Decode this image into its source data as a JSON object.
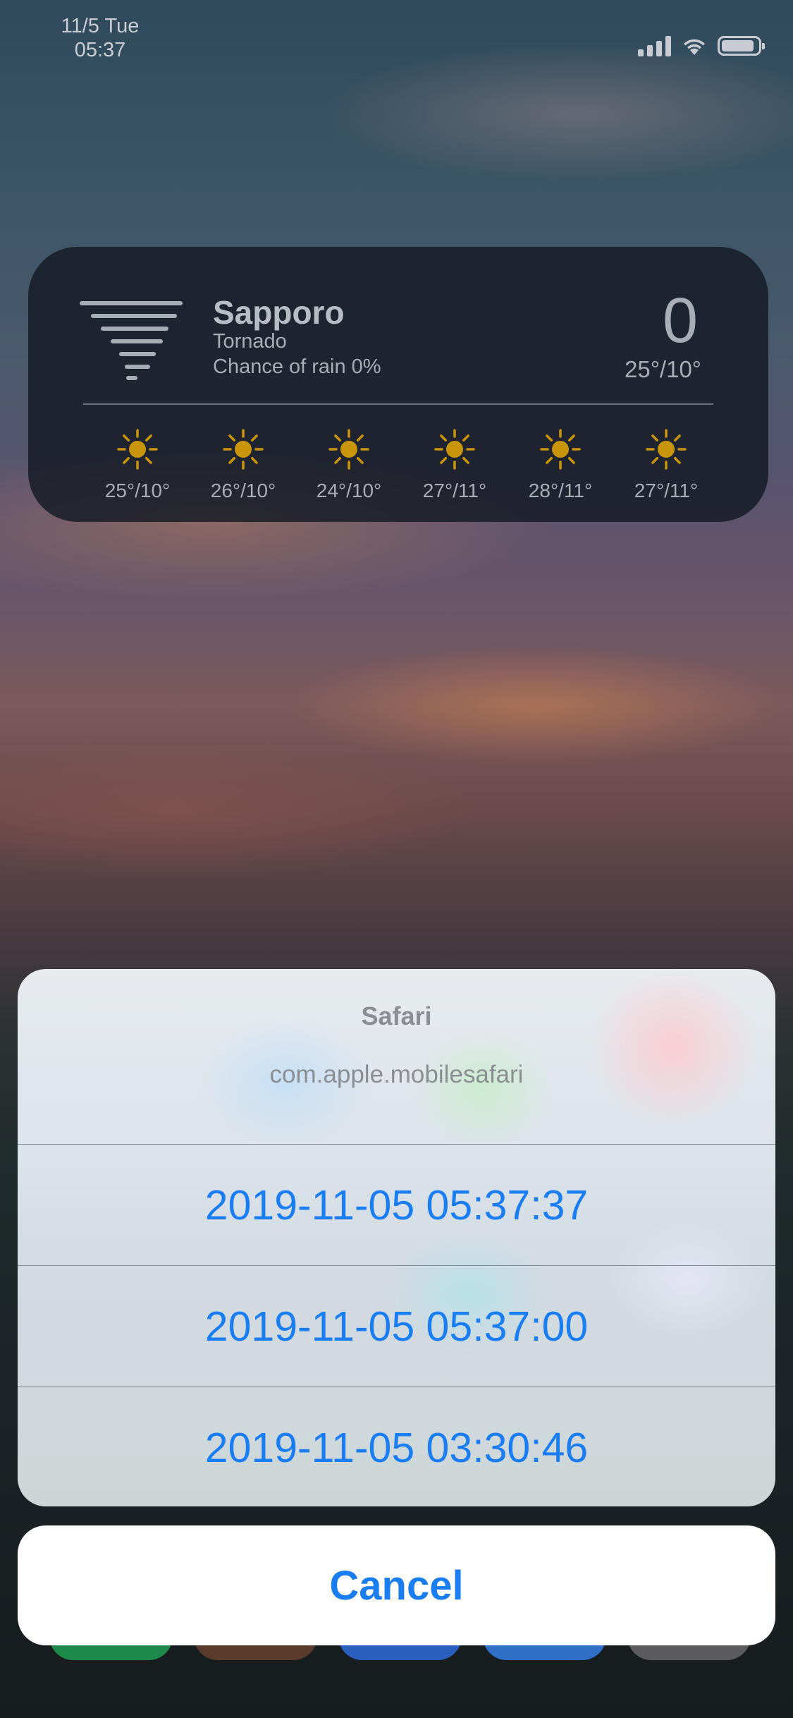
{
  "status_bar": {
    "date": "11/5 Tue",
    "time": "05:37",
    "battery_level": 0.9
  },
  "weather_widget": {
    "icon": "tornado-icon",
    "city": "Sapporo",
    "condition": "Tornado",
    "chance_of_rain": "Chance of rain 0%",
    "current_temp": "0",
    "temp_range": "25°/10°",
    "forecast": [
      {
        "icon": "sun-icon",
        "temp": "25°/10°"
      },
      {
        "icon": "sun-icon",
        "temp": "26°/10°"
      },
      {
        "icon": "sun-icon",
        "temp": "24°/10°"
      },
      {
        "icon": "sun-icon",
        "temp": "27°/11°"
      },
      {
        "icon": "sun-icon",
        "temp": "28°/11°"
      },
      {
        "icon": "sun-icon",
        "temp": "27°/11°"
      }
    ]
  },
  "action_sheet": {
    "title": "Safari",
    "subtitle": "com.apple.mobilesafari",
    "options": [
      "2019-11-05 05:37:37",
      "2019-11-05 05:37:00",
      "2019-11-05 03:30:46"
    ],
    "cancel_label": "Cancel"
  },
  "colors": {
    "accent": "#1a7ef2",
    "sun": "#c9950a"
  }
}
